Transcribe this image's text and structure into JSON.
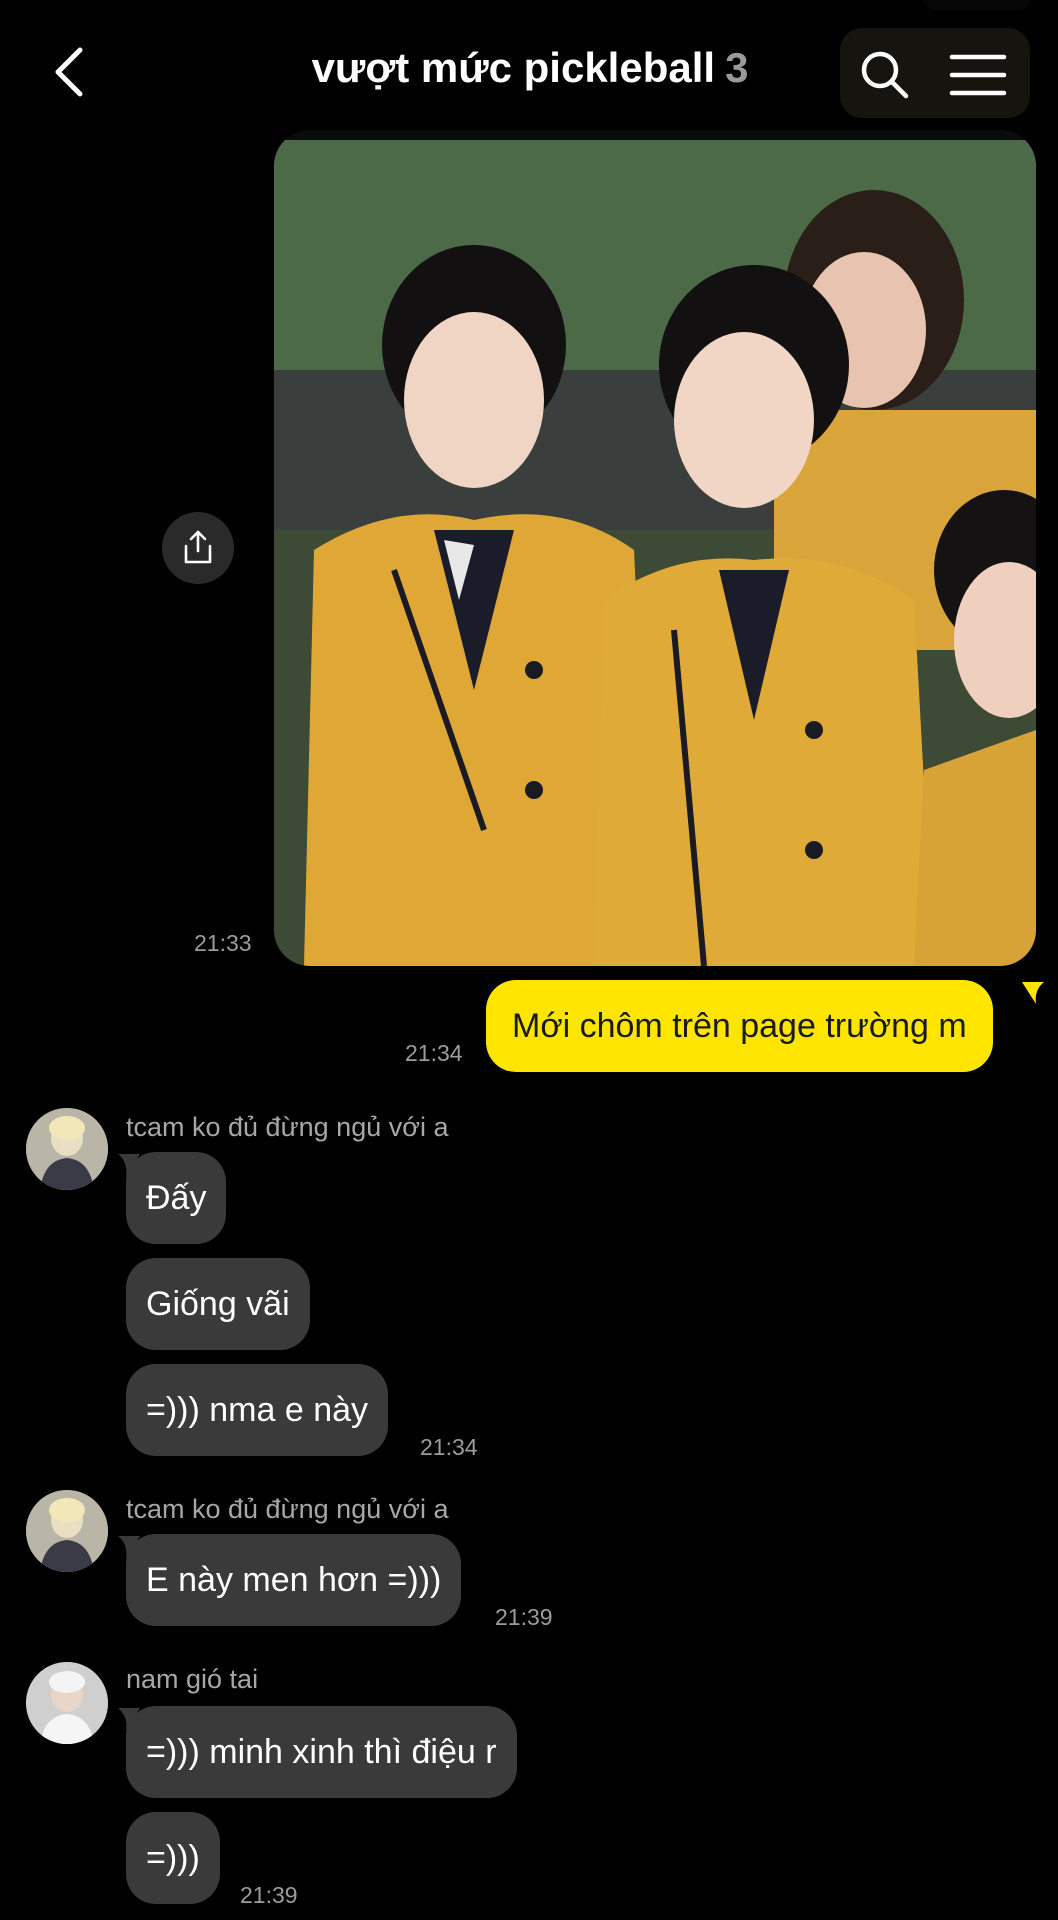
{
  "header": {
    "title": "vượt mức pickleball",
    "member_count": "3"
  },
  "colors": {
    "outgoing_bubble": "#fee500",
    "incoming_bubble": "#3a3a3a",
    "background": "#000000"
  },
  "messages": {
    "photo_time": "21:33",
    "outgoing_text": "Mới chôm trên page trường m",
    "outgoing_time": "21:34",
    "group1": {
      "sender": "tcam ko đủ đừng ngủ với a",
      "m1": "Đấy",
      "m2": "Giống vãi",
      "m3": "=))) nma e này",
      "time": "21:34"
    },
    "group2": {
      "sender": "tcam ko đủ đừng ngủ với a",
      "m1": "E này men hơn =)))",
      "time": "21:39"
    },
    "group3": {
      "sender": "nam gió tai",
      "m1": "=))) minh xinh thì điệu r",
      "m2": "=)))",
      "time": "21:39"
    }
  },
  "icons": {
    "back": "chevron-left-icon",
    "search": "search-icon",
    "menu": "hamburger-menu-icon",
    "share": "share-icon"
  }
}
